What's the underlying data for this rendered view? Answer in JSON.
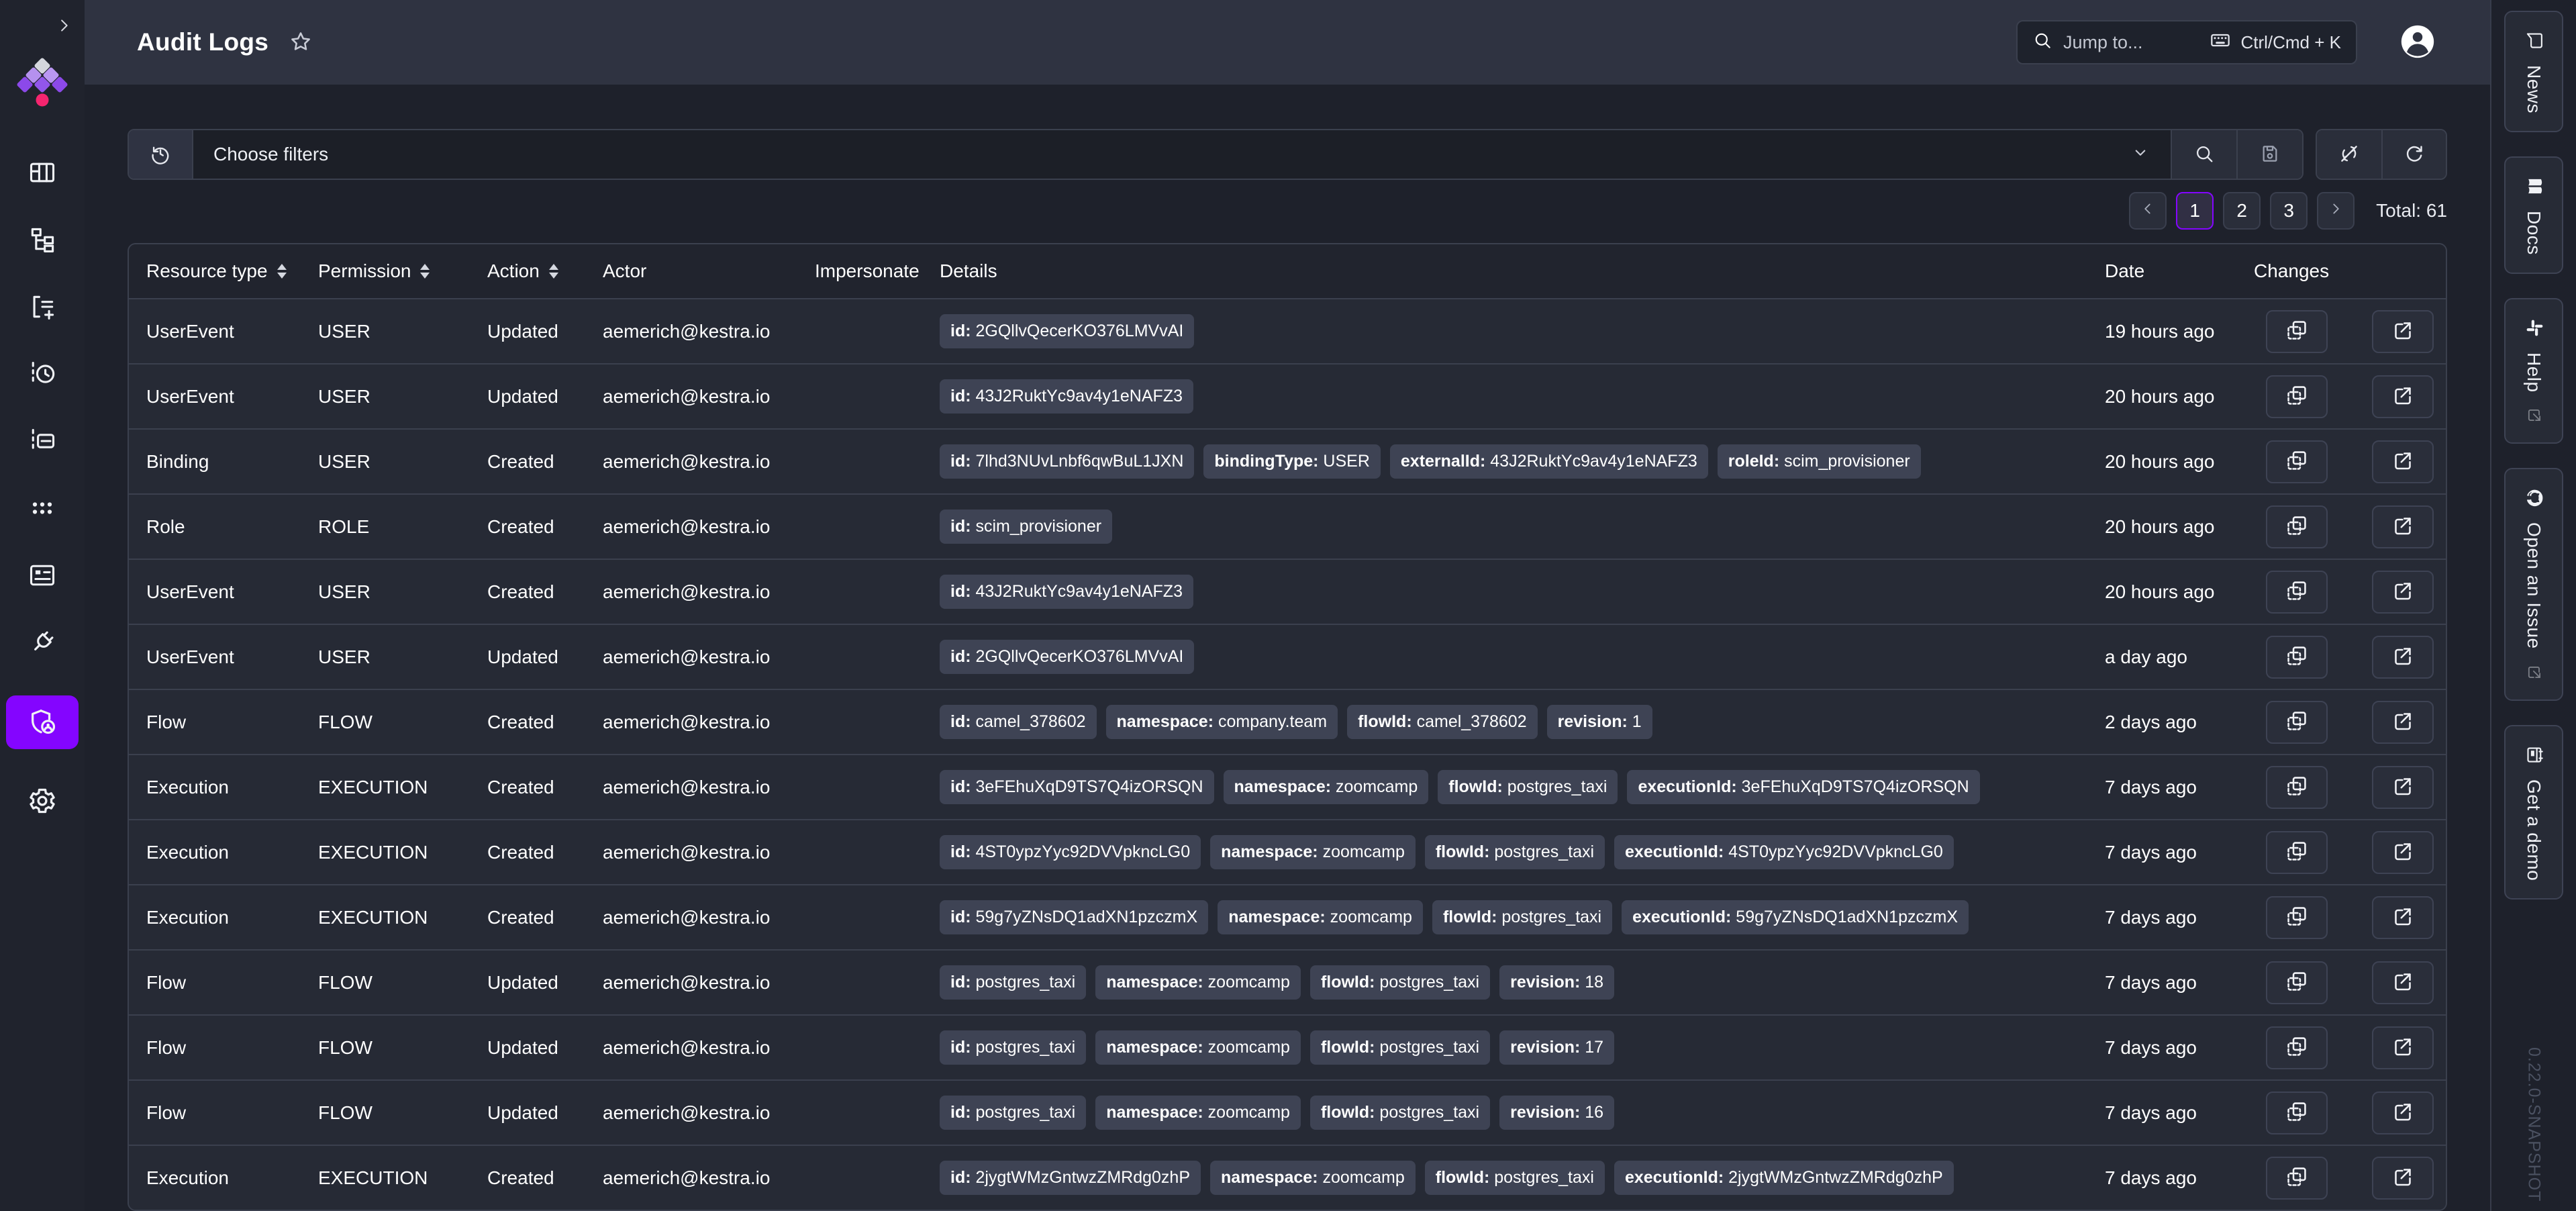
{
  "colors": {
    "accent_purple": "#8405FF",
    "logo_pink": "#F5256F",
    "header_bg": "#2F3341",
    "page_bg": "#1E212B",
    "row_bg": "#262A35",
    "badge_bg": "#3E4354"
  },
  "sidebar": {
    "collapse_icon": "chevron-right",
    "items": [
      "dashboards",
      "flows",
      "templates",
      "executions",
      "logs",
      "apps",
      "blueprints",
      "plugins",
      "administration",
      "settings"
    ],
    "active_item": "administration"
  },
  "header": {
    "title": "Audit Logs",
    "search_placeholder": "Jump to...",
    "search_shortcut": "Ctrl/Cmd + K"
  },
  "filters": {
    "placeholder": "Choose filters"
  },
  "pagination": {
    "pages": [
      "1",
      "2",
      "3"
    ],
    "active_page": "1",
    "total": "Total: 61"
  },
  "table": {
    "columns": [
      {
        "label": "Resource type",
        "sortable": true
      },
      {
        "label": "Permission",
        "sortable": true
      },
      {
        "label": "Action",
        "sortable": true
      },
      {
        "label": "Actor",
        "sortable": false
      },
      {
        "label": "Impersonate",
        "sortable": false
      },
      {
        "label": "Details",
        "sortable": false
      },
      {
        "label": "Date",
        "sortable": false
      },
      {
        "label": "Changes",
        "sortable": false
      }
    ],
    "rows": [
      {
        "resource_type": "UserEvent",
        "permission": "USER",
        "action": "Updated",
        "actor": "aemerich@kestra.io",
        "impersonate": "",
        "details": [
          {
            "key": "id",
            "value": "2GQllvQecerKO376LMVvAI"
          }
        ],
        "date": "19 hours ago"
      },
      {
        "resource_type": "UserEvent",
        "permission": "USER",
        "action": "Updated",
        "actor": "aemerich@kestra.io",
        "impersonate": "",
        "details": [
          {
            "key": "id",
            "value": "43J2RuktYc9av4y1eNAFZ3"
          }
        ],
        "date": "20 hours ago"
      },
      {
        "resource_type": "Binding",
        "permission": "USER",
        "action": "Created",
        "actor": "aemerich@kestra.io",
        "impersonate": "",
        "details": [
          {
            "key": "id",
            "value": "7lhd3NUvLnbf6qwBuL1JXN"
          },
          {
            "key": "bindingType",
            "value": "USER"
          },
          {
            "key": "externalId",
            "value": "43J2RuktYc9av4y1eNAFZ3"
          },
          {
            "key": "roleId",
            "value": "scim_provisioner"
          }
        ],
        "date": "20 hours ago"
      },
      {
        "resource_type": "Role",
        "permission": "ROLE",
        "action": "Created",
        "actor": "aemerich@kestra.io",
        "impersonate": "",
        "details": [
          {
            "key": "id",
            "value": "scim_provisioner"
          }
        ],
        "date": "20 hours ago"
      },
      {
        "resource_type": "UserEvent",
        "permission": "USER",
        "action": "Created",
        "actor": "aemerich@kestra.io",
        "impersonate": "",
        "details": [
          {
            "key": "id",
            "value": "43J2RuktYc9av4y1eNAFZ3"
          }
        ],
        "date": "20 hours ago"
      },
      {
        "resource_type": "UserEvent",
        "permission": "USER",
        "action": "Updated",
        "actor": "aemerich@kestra.io",
        "impersonate": "",
        "details": [
          {
            "key": "id",
            "value": "2GQllvQecerKO376LMVvAI"
          }
        ],
        "date": "a day ago"
      },
      {
        "resource_type": "Flow",
        "permission": "FLOW",
        "action": "Created",
        "actor": "aemerich@kestra.io",
        "impersonate": "",
        "details": [
          {
            "key": "id",
            "value": "camel_378602"
          },
          {
            "key": "namespace",
            "value": "company.team"
          },
          {
            "key": "flowId",
            "value": "camel_378602"
          },
          {
            "key": "revision",
            "value": "1"
          }
        ],
        "date": "2 days ago"
      },
      {
        "resource_type": "Execution",
        "permission": "EXECUTION",
        "action": "Created",
        "actor": "aemerich@kestra.io",
        "impersonate": "",
        "details": [
          {
            "key": "id",
            "value": "3eFEhuXqD9TS7Q4izORSQN"
          },
          {
            "key": "namespace",
            "value": "zoomcamp"
          },
          {
            "key": "flowId",
            "value": "postgres_taxi"
          },
          {
            "key": "executionId",
            "value": "3eFEhuXqD9TS7Q4izORSQN"
          }
        ],
        "date": "7 days ago"
      },
      {
        "resource_type": "Execution",
        "permission": "EXECUTION",
        "action": "Created",
        "actor": "aemerich@kestra.io",
        "impersonate": "",
        "details": [
          {
            "key": "id",
            "value": "4ST0ypzYyc92DVVpkncLG0"
          },
          {
            "key": "namespace",
            "value": "zoomcamp"
          },
          {
            "key": "flowId",
            "value": "postgres_taxi"
          },
          {
            "key": "executionId",
            "value": "4ST0ypzYyc92DVVpkncLG0"
          }
        ],
        "date": "7 days ago"
      },
      {
        "resource_type": "Execution",
        "permission": "EXECUTION",
        "action": "Created",
        "actor": "aemerich@kestra.io",
        "impersonate": "",
        "details": [
          {
            "key": "id",
            "value": "59g7yZNsDQ1adXN1pzczmX"
          },
          {
            "key": "namespace",
            "value": "zoomcamp"
          },
          {
            "key": "flowId",
            "value": "postgres_taxi"
          },
          {
            "key": "executionId",
            "value": "59g7yZNsDQ1adXN1pzczmX"
          }
        ],
        "date": "7 days ago"
      },
      {
        "resource_type": "Flow",
        "permission": "FLOW",
        "action": "Updated",
        "actor": "aemerich@kestra.io",
        "impersonate": "",
        "details": [
          {
            "key": "id",
            "value": "postgres_taxi"
          },
          {
            "key": "namespace",
            "value": "zoomcamp"
          },
          {
            "key": "flowId",
            "value": "postgres_taxi"
          },
          {
            "key": "revision",
            "value": "18"
          }
        ],
        "date": "7 days ago"
      },
      {
        "resource_type": "Flow",
        "permission": "FLOW",
        "action": "Updated",
        "actor": "aemerich@kestra.io",
        "impersonate": "",
        "details": [
          {
            "key": "id",
            "value": "postgres_taxi"
          },
          {
            "key": "namespace",
            "value": "zoomcamp"
          },
          {
            "key": "flowId",
            "value": "postgres_taxi"
          },
          {
            "key": "revision",
            "value": "17"
          }
        ],
        "date": "7 days ago"
      },
      {
        "resource_type": "Flow",
        "permission": "FLOW",
        "action": "Updated",
        "actor": "aemerich@kestra.io",
        "impersonate": "",
        "details": [
          {
            "key": "id",
            "value": "postgres_taxi"
          },
          {
            "key": "namespace",
            "value": "zoomcamp"
          },
          {
            "key": "flowId",
            "value": "postgres_taxi"
          },
          {
            "key": "revision",
            "value": "16"
          }
        ],
        "date": "7 days ago"
      },
      {
        "resource_type": "Execution",
        "permission": "EXECUTION",
        "action": "Created",
        "actor": "aemerich@kestra.io",
        "impersonate": "",
        "details": [
          {
            "key": "id",
            "value": "2jygtWMzGntwzZMRdg0zhP"
          },
          {
            "key": "namespace",
            "value": "zoomcamp"
          },
          {
            "key": "flowId",
            "value": "postgres_taxi"
          },
          {
            "key": "executionId",
            "value": "2jygtWMzGntwzZMRdg0zhP"
          }
        ],
        "date": "7 days ago"
      }
    ]
  },
  "rail": {
    "tabs": [
      {
        "label": "News",
        "icon": "message-icon",
        "external": false
      },
      {
        "label": "Docs",
        "icon": "book-icon",
        "external": false
      },
      {
        "label": "Help",
        "icon": "slack-icon",
        "external": true
      },
      {
        "label": "Open an Issue",
        "icon": "github-icon",
        "external": true
      },
      {
        "label": "Get a demo",
        "icon": "calendar-icon",
        "external": false
      }
    ],
    "version": "0.22.0-SNAPSHOT"
  }
}
